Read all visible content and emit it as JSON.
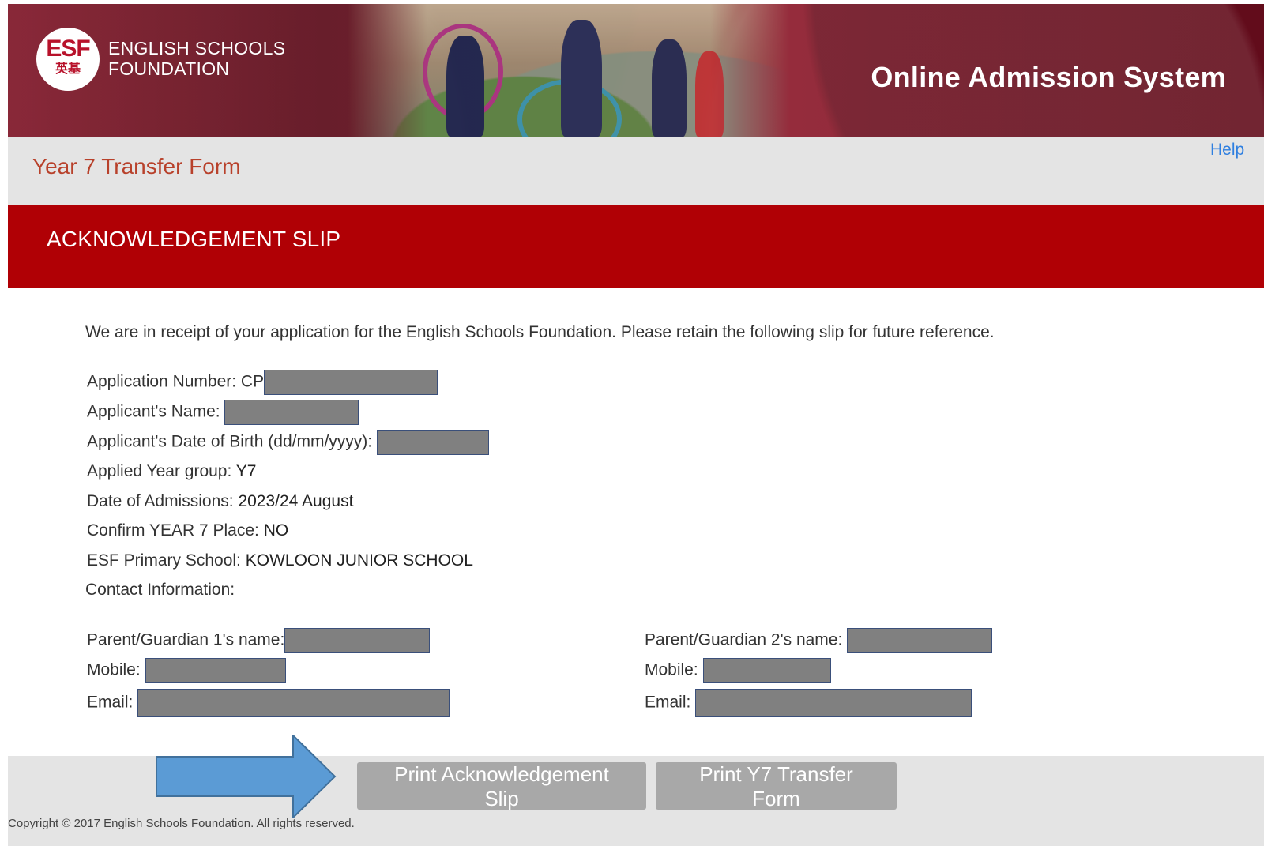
{
  "header": {
    "logo_text": "ESF",
    "logo_chinese": "英基",
    "org_name_line1": "ENGLISH SCHOOLS",
    "org_name_line2": "FOUNDATION",
    "system_title": "Online Admission System"
  },
  "title_bar": {
    "page_title": "Year 7 Transfer Form",
    "help_link": "Help"
  },
  "slip": {
    "title": "ACKNOWLEDGEMENT SLIP",
    "receipt_text": "We are in receipt of your application for the English Schools Foundation. Please retain the following slip for future reference.",
    "application_number_label": "Application Number: CP",
    "applicant_name_label": "Applicant's Name:",
    "dob_label": "Applicant's Date of Birth (dd/mm/yyyy):",
    "year_group_label": "Applied Year group:",
    "year_group_value": "Y7",
    "admission_date_label": "Date of Admissions:",
    "admission_date_value": "2023/24 August",
    "confirm_label": "Confirm YEAR 7 Place:",
    "confirm_value": "NO",
    "primary_school_label": "ESF Primary School:",
    "primary_school_value": "KOWLOON JUNIOR SCHOOL",
    "contact_label": "Contact Information:",
    "parent1": {
      "name_label": "Parent/Guardian 1's name:",
      "mobile_label": "Mobile:",
      "email_label": "Email:"
    },
    "parent2": {
      "name_label": "Parent/Guardian 2's name:",
      "mobile_label": "Mobile:",
      "email_label": "Email:"
    }
  },
  "footer": {
    "print_slip_button": "Print Acknowledgement Slip",
    "print_form_button": "Print Y7 Transfer Form",
    "copyright": "Copyright © 2017 English Schools Foundation. All rights reserved."
  },
  "colors": {
    "banner": "#8a1426",
    "section_header": "#b00005",
    "page_title": "#b8412b",
    "help_link": "#2f7fe0",
    "button": "#a8a8a8",
    "arrow": "#5b9bd5",
    "redaction": "#808080"
  }
}
